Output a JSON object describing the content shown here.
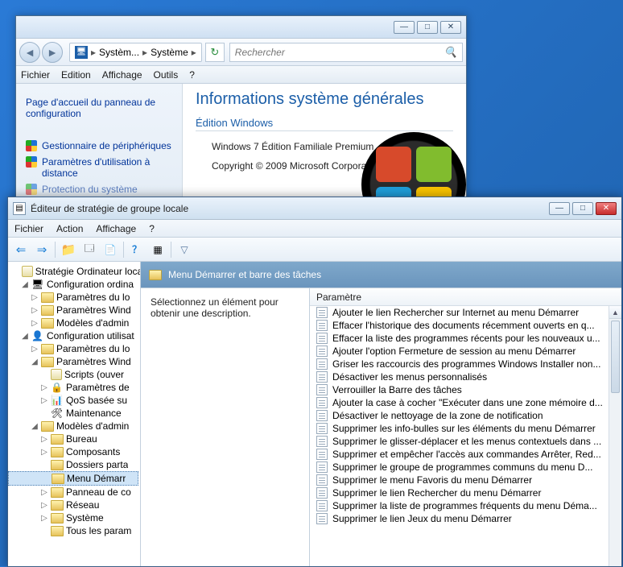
{
  "system_window": {
    "caption_buttons": {
      "min": "—",
      "max": "□",
      "close": "✕"
    },
    "breadcrumb": {
      "item1": "Systèm...",
      "item2": "Système",
      "sep": "▸"
    },
    "refresh_glyph": "↻",
    "search": {
      "placeholder": "Rechercher",
      "mag": "🔍"
    },
    "menubar": [
      "Fichier",
      "Edition",
      "Affichage",
      "Outils",
      "?"
    ],
    "left_links": {
      "home": "Page d'accueil du panneau de configuration",
      "devmgr": "Gestionnaire de périphériques",
      "remote": "Paramètres d'utilisation à distance",
      "prot": "Protection du système"
    },
    "right": {
      "heading": "Informations système générales",
      "group": "Édition Windows",
      "edition": "Windows 7 Édition Familiale Premium",
      "copyright": "Copyright © 2009 Microsoft Corporation."
    }
  },
  "gpedit_window": {
    "title": "Éditeur de stratégie de groupe locale",
    "menubar": [
      "Fichier",
      "Action",
      "Affichage",
      "?"
    ],
    "toolbar_glyphs": {
      "back": "⇐",
      "fwd": "⇒",
      "up": "📁",
      "props": "🗔",
      "export": "📄",
      "help": "？",
      "gpupdate": "▦",
      "filter": "▽"
    },
    "tree": {
      "root": "Stratégie Ordinateur loca",
      "cfg_ord": "Configuration ordina",
      "p_log1": "Paramètres du lo",
      "p_win1": "Paramètres Wind",
      "m_adm1": "Modèles d'admin",
      "cfg_usr": "Configuration utilisat",
      "p_log2": "Paramètres du lo",
      "p_win2": "Paramètres Wind",
      "scripts": "Scripts (ouver",
      "p_de": "Paramètres de",
      "qos": "QoS basée su",
      "maint": "Maintenance",
      "m_adm2": "Modèles d'admin",
      "bureau": "Bureau",
      "comp": "Composants",
      "doss": "Dossiers parta",
      "menu_dem": "Menu Démarr",
      "panneau": "Panneau de co",
      "reseau": "Réseau",
      "systeme": "Système",
      "tous": "Tous les param"
    },
    "right_head": "Menu Démarrer et barre des tâches",
    "desc": "Sélectionnez un élément pour obtenir une description.",
    "col_header": "Paramètre",
    "items": [
      "Ajouter le lien Rechercher sur Internet au menu Démarrer",
      "Effacer l'historique des documents récemment ouverts en q...",
      "Effacer la liste des programmes récents pour les nouveaux u...",
      "Ajouter l'option Fermeture de session au menu Démarrer",
      "Griser les raccourcis des programmes Windows Installer non...",
      "Désactiver les menus personnalisés",
      "Verrouiller la Barre des tâches",
      "Ajouter la case à cocher \"Exécuter dans une zone mémoire d...",
      "Désactiver le nettoyage de la zone de notification",
      "Supprimer les info-bulles sur les éléments du menu Démarrer",
      "Supprimer le glisser-déplacer et les menus contextuels dans ...",
      "Supprimer et empêcher l'accès aux commandes Arrêter, Red...",
      "Supprimer le groupe de programmes communs du menu D...",
      "Supprimer le menu Favoris du menu Démarrer",
      "Supprimer le lien Rechercher du menu Démarrer",
      "Supprimer la liste de programmes fréquents du menu Déma...",
      "Supprimer le lien Jeux du menu Démarrer"
    ]
  }
}
